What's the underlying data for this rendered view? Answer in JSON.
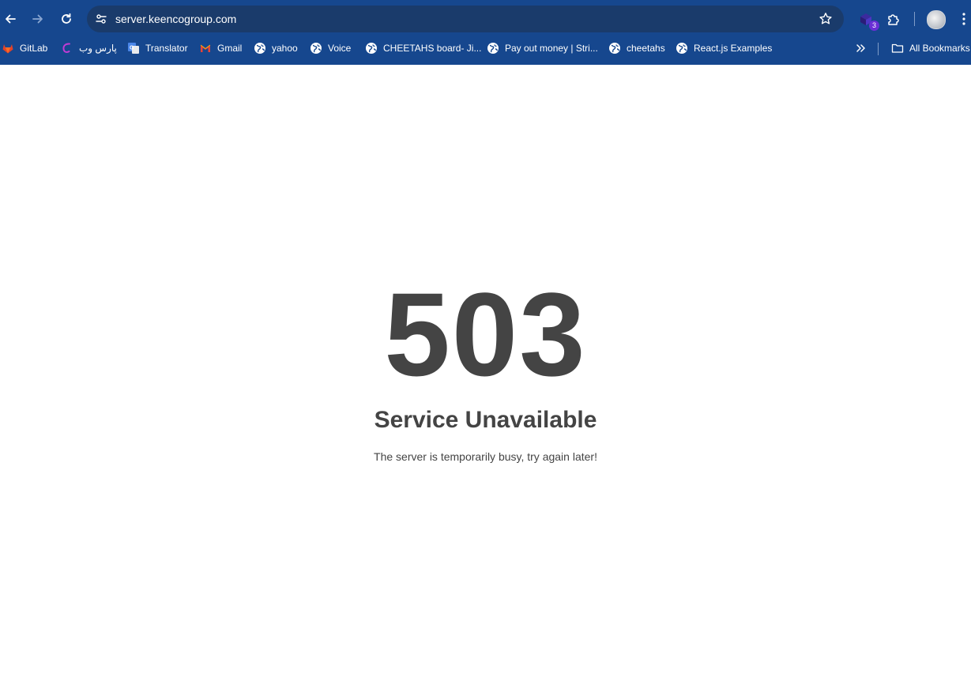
{
  "browser": {
    "url": "server.keencogroup.com",
    "extension_badge": "3",
    "bookmarks": [
      {
        "label": "GitLab",
        "icon": "gitlab-icon"
      },
      {
        "label": "پارس وب",
        "icon": "parsweb-icon"
      },
      {
        "label": "Translator",
        "icon": "google-translate-icon"
      },
      {
        "label": "Gmail",
        "icon": "gmail-icon"
      },
      {
        "label": "yahoo",
        "icon": "globe-icon"
      },
      {
        "label": "Voice",
        "icon": "globe-icon"
      },
      {
        "label": "CHEETAHS board- Ji...",
        "icon": "globe-icon"
      },
      {
        "label": "Pay out money | Stri...",
        "icon": "globe-icon"
      },
      {
        "label": "cheetahs",
        "icon": "globe-icon"
      },
      {
        "label": "React.js Examples",
        "icon": "globe-icon"
      }
    ],
    "all_bookmarks_label": "All Bookmarks",
    "colors": {
      "chrome_bg": "#16478e",
      "omnibox_bg": "#1a3b6b"
    }
  },
  "page": {
    "code": "503",
    "title": "Service Unavailable",
    "message": "The server is temporarily busy, try again later!",
    "text_color": "#444444"
  }
}
